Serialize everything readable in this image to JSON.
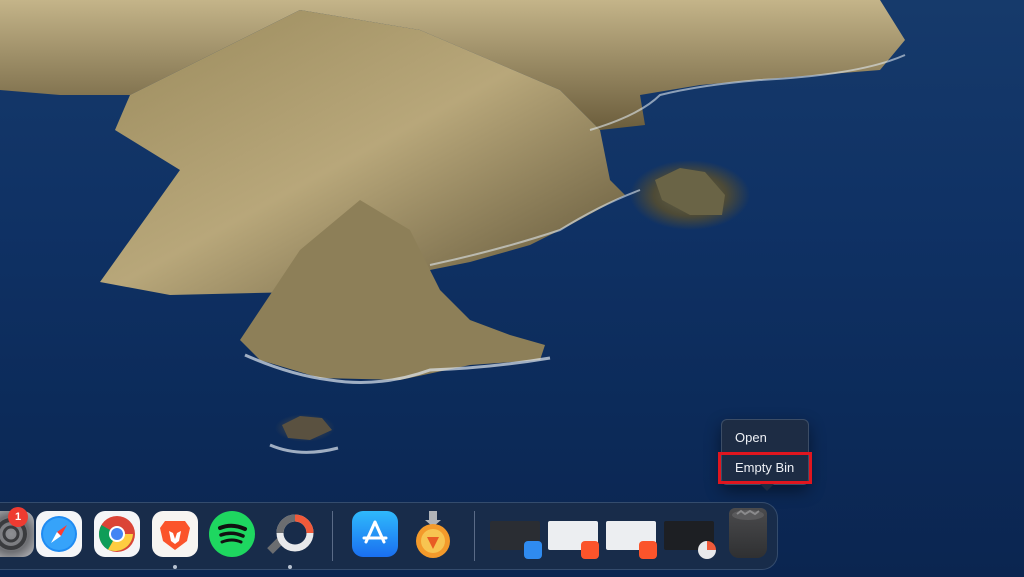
{
  "desktop": {
    "wallpaper": "macOS Catalina coastal island cliffs over ocean"
  },
  "context_menu": {
    "items": [
      {
        "label": "Open"
      },
      {
        "label": "Empty Bin",
        "highlighted": true
      }
    ],
    "highlight_color": "#e0161f"
  },
  "dock": {
    "apps": [
      {
        "name": "System Preferences",
        "icon": "gear-icon",
        "badge": "1"
      },
      {
        "name": "Safari",
        "icon": "safari-compass-icon",
        "running": false
      },
      {
        "name": "Google Chrome",
        "icon": "chrome-icon",
        "running": false
      },
      {
        "name": "Brave Browser",
        "icon": "brave-lion-icon",
        "running": true
      },
      {
        "name": "Spotify",
        "icon": "spotify-icon",
        "running": false
      },
      {
        "name": "PDF Search",
        "icon": "ring-chart-icon",
        "running": true
      },
      {
        "name": "App Store",
        "icon": "app-store-icon",
        "running": false
      },
      {
        "name": "Installer",
        "icon": "installer-flask-icon",
        "running": false
      }
    ],
    "minimized_windows": [
      {
        "app": "Finder",
        "theme": "dark",
        "badge_icon": "finder-icon"
      },
      {
        "app": "Brave Browser",
        "theme": "light",
        "badge_icon": "brave-lion-icon"
      },
      {
        "app": "Brave Browser",
        "theme": "light",
        "badge_icon": "brave-lion-icon"
      },
      {
        "app": "PDF Search",
        "theme": "dark",
        "badge_icon": "ring-chart-icon"
      }
    ],
    "trash": {
      "name": "Bin",
      "icon": "trash-full-icon"
    }
  },
  "colors": {
    "ocean": "#0f3164",
    "dock_bg": "#1c2e48",
    "badge_red": "#ee3b31"
  }
}
